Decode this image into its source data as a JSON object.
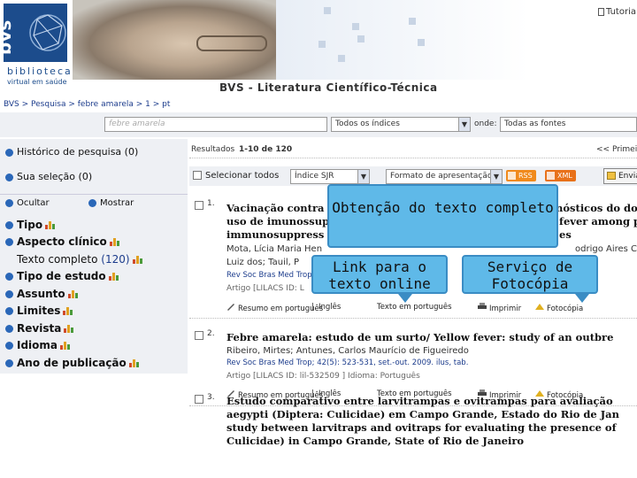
{
  "header": {
    "logo_text_line1": "biblioteca",
    "logo_text_line2": "virtual em saúde",
    "logo_mark": "bvs",
    "site_title": "BVS - Literatura Científico-Técnica",
    "tutorial_label": "Tutoria"
  },
  "breadcrumb": "BVS > Pesquisa > febre amarela > 1 > pt",
  "search": {
    "value": "febre amarela",
    "index_select": "Todos os índices",
    "where_label": "onde:",
    "source_select": "Todas as fontes"
  },
  "sidebar": {
    "history_label": "Histórico de pesquisa",
    "history_count": "(0)",
    "selection_label": "Sua seleção",
    "selection_count": "(0)",
    "hide_label": "Ocultar",
    "show_label": "Mostrar",
    "facets": [
      {
        "label": "Tipo",
        "bullet": true
      },
      {
        "label": "Aspecto clínico",
        "bullet": true
      },
      {
        "label": "Texto completo",
        "bullet": false,
        "count": "(120)"
      },
      {
        "label": "Tipo de estudo",
        "bullet": true
      },
      {
        "label": "Assunto",
        "bullet": true
      },
      {
        "label": "Limites",
        "bullet": true
      },
      {
        "label": "Revista",
        "bullet": true
      },
      {
        "label": "Idioma",
        "bullet": true
      },
      {
        "label": "Ano de publicação",
        "bullet": true
      }
    ]
  },
  "results": {
    "summary_label": "Resultados",
    "summary_range": "1-10 de 120",
    "first_page": "<< Primeira",
    "select_all": "Selecionar todos",
    "sort_select": "Índice SJR",
    "format_select": "Formato de apresentação",
    "rss_label": "RSS",
    "xml_label": "XML",
    "send_label": "Enviar r"
  },
  "records": [
    {
      "num": "1.",
      "title_lines": [
        "Vacinação contra",
        "uso de imunossup",
        "immunosuppress"
      ],
      "title_right": [
        "nósticos do do",
        "fever among p",
        "es"
      ],
      "authors": "Mota, Lícia Maria Hen",
      "authors_right": "odrigo Aires Co",
      "authors2": "Luiz dos; Tauil, P",
      "source": "Rev Soc Bras Med Trop",
      "id_line": "Artigo [LILACS ID: L",
      "abstract_pt": "Resumo em português",
      "abstract_en": "Inglês",
      "fulltext": "Texto em português",
      "print": "Imprimir",
      "photocopy": "Fotocópia"
    },
    {
      "num": "2.",
      "title_lines": [
        "Febre amarela: estudo de um surto/ Yellow fever: study of an outbre"
      ],
      "authors": "Ribeiro, Mirtes; Antunes, Carlos Maurício de Figueiredo",
      "source": "Rev Soc Bras Med Trop; 42(5): 523-531, set.-out. 2009. ilus, tab.",
      "id_line": "Artigo [LILACS ID: lil-532509 ] Idioma: Português",
      "abstract_pt": "Resumo em português",
      "abstract_en": "Inglês",
      "fulltext": "Texto em português",
      "print": "Imprimir",
      "photocopy": "Fotocópia"
    },
    {
      "num": "3.",
      "title_lines": [
        "Estudo comparativo entre larvitrampas e ovitrampas para avaliação",
        "aegypti (Diptera: Culicidae) em Campo Grande, Estado do Rio de Jan",
        "study between larvitraps and ovitraps for evaluating the presence of",
        "Culicidae) in Campo Grande, State of Rio de Janeiro"
      ]
    }
  ],
  "callouts": {
    "main": "Obtenção do texto completo",
    "link": "Link para o texto online",
    "photocopy": "Serviço de Fotocópia"
  },
  "colors": {
    "brand_blue": "#1c4c8c",
    "link_blue": "#1c3c8c",
    "bullet_blue": "#2a67b8",
    "callout_fill": "#5fb9e8",
    "rss_orange": "#f08a1c",
    "xml_orange": "#e8711a"
  }
}
